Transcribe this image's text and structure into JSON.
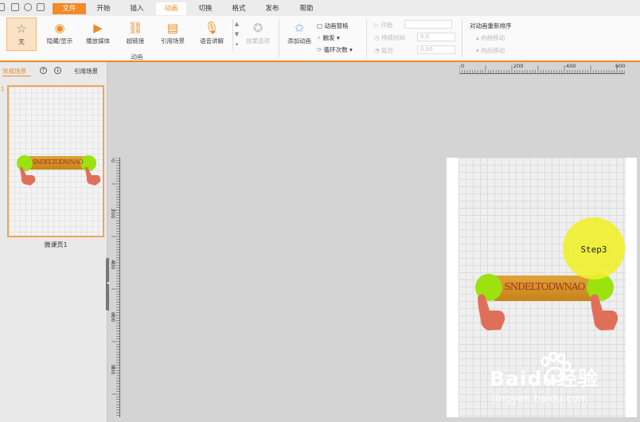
{
  "menubar": {
    "tabs": [
      "文件",
      "开始",
      "插入",
      "动画",
      "切换",
      "格式",
      "发布",
      "帮助"
    ],
    "active": "动画"
  },
  "ribbon": {
    "buttons": [
      "无",
      "隐藏/显示",
      "播放媒体",
      "超链接",
      "引用场景",
      "语音讲解",
      "效果选项"
    ],
    "group_label": "动画",
    "add_animation": "添加动画",
    "animation_pane": "动画窗格",
    "trigger": "触发",
    "loop_count": "循环次数",
    "timing": {
      "start_label": "开始",
      "duration_label": "持续时间",
      "duration_value": "0.0",
      "delay_label": "延迟",
      "delay_value": "0.00"
    },
    "reorder": {
      "title": "对动画重新排序",
      "forward": "向前移动",
      "backward": "向后移动"
    }
  },
  "leftpanel": {
    "tab_normal": "常规场景",
    "tab_ref": "引用场景",
    "slide_number": "1",
    "slide_label": "微课页1"
  },
  "rulers": {
    "h_ticks": [
      "0",
      "200",
      "400",
      "600"
    ],
    "v_ticks": [
      "0",
      "200",
      "400",
      "600",
      "800"
    ]
  },
  "canvas": {
    "bar_text": "SNDELTODWNAO",
    "step_label": "Step3"
  },
  "watermark": {
    "brand": "Baidu经验",
    "url": "jingyan.baidu.com"
  },
  "colors": {
    "accent": "#f08a24",
    "bar": "#d49327",
    "green": "#9be20f",
    "hand": "#e06f5a",
    "step": "#f0f028"
  }
}
